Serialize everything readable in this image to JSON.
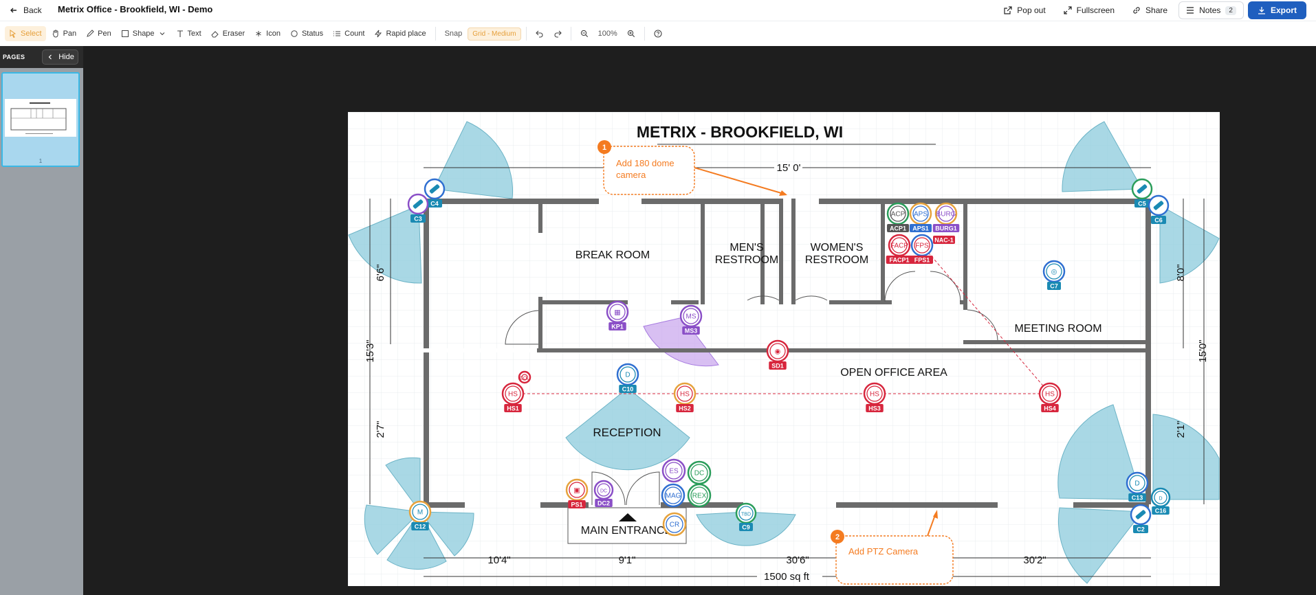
{
  "header": {
    "back_label": "Back",
    "title": "Metrix Office - Brookfield, WI - Demo",
    "popout_label": "Pop out",
    "fullscreen_label": "Fullscreen",
    "share_label": "Share",
    "notes_label": "Notes",
    "notes_count": "2",
    "export_label": "Export"
  },
  "toolbar": {
    "tools": [
      "Select",
      "Pan",
      "Pen",
      "Shape",
      "Text",
      "Eraser",
      "Icon",
      "Status",
      "Count",
      "Rapid place"
    ],
    "snap_label": "Snap",
    "grid_label": "Grid - Medium",
    "zoom": "100%"
  },
  "sidebar": {
    "pages_label": "PAGES",
    "hide_label": "Hide",
    "page_number": "1"
  },
  "plan": {
    "title": "METRIX - BROOKFIELD, WI",
    "rooms": {
      "break": "BREAK ROOM",
      "mens1": "MEN'S",
      "mens2": "RESTROOM",
      "womens1": "WOMEN'S",
      "womens2": "RESTROOM",
      "meeting": "MEETING ROOM",
      "open": "OPEN OFFICE AREA",
      "reception": "RECEPTION",
      "entrance": "MAIN ENTRANCE"
    },
    "dims": {
      "top": "15' 0'",
      "left_upper": "6'6\"",
      "left_total": "15'3\"",
      "left_lower": "2'7\"",
      "right_upper": "8'0\"",
      "right_total": "15'0\"",
      "right_lower": "2'1\"",
      "bot1": "10'4\"",
      "bot2": "9'1\"",
      "bot3": "30'6\"",
      "bot4": "30'2\"",
      "area": "1500 sq ft"
    },
    "notes": [
      {
        "num": "1",
        "line1": "Add 180 dome",
        "line2": "camera"
      },
      {
        "num": "2",
        "line1": "Add PTZ Camera",
        "line2": ""
      }
    ],
    "device_tags": {
      "C3": "C3",
      "C4": "C4",
      "C5": "C5",
      "C6": "C6",
      "C7": "C7",
      "C9": "C9",
      "C10": "C10",
      "C12": "C12",
      "C13": "C13",
      "C16": "C16",
      "C2": "C2",
      "ACP1": "ACP1",
      "APS1": "APS1",
      "BURG1": "BURG1",
      "NAC1": "NAC-1",
      "FACP1": "FACP1",
      "FPS1": "FPS1",
      "KP1": "KP1",
      "MS3": "MS3",
      "SD1": "SD1",
      "HS1": "HS1",
      "HS2": "HS2",
      "HS3": "HS3",
      "HS4": "HS4",
      "PS1": "PS1",
      "DC2": "DC2"
    },
    "device_icons": {
      "ACP": "ACP",
      "APS": "APS",
      "BURG": "BURG",
      "FACP": "FACP",
      "FPS": "FPS",
      "MS": "MS",
      "HS": "HS",
      "D": "D",
      "M": "M",
      "DC": "DC",
      "ES": "ES",
      "MAG": "MAG",
      "REX": "REX",
      "CR": "CR",
      "COL": "COL",
      "SD": "SD",
      "TBD": "TBD"
    }
  },
  "colors": {
    "accent": "#1f5fbf",
    "select_bg": "#fdf0dc",
    "select_fg": "#e6a03c",
    "note_orange": "#f47b20",
    "camera_blue": "#1a8ab3",
    "coverage": "#8ccbdc",
    "motion_purple": "#8a4fc7",
    "fire_red": "#d7263d"
  }
}
